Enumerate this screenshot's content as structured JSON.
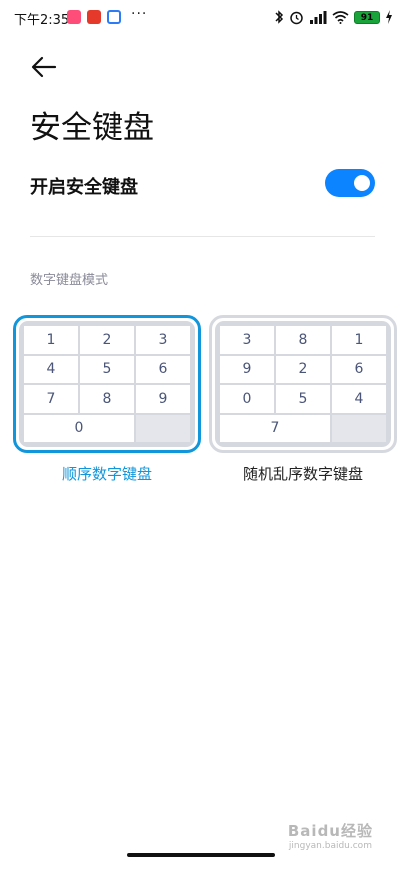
{
  "status_bar": {
    "time": "下午2:35",
    "dots": "···",
    "battery": "91",
    "app_icon_colors": [
      "#ff4d7a",
      "#e5392b",
      "#2d7cf6"
    ]
  },
  "header": {
    "back_icon": "arrow-left-icon",
    "title": "安全键盘"
  },
  "settings": {
    "toggle_label": "开启安全键盘",
    "toggle_on": true,
    "accent_color": "#0d84ff"
  },
  "section_title": "数字键盘模式",
  "keyboards": {
    "sequential": {
      "caption": "顺序数字键盘",
      "selected": true,
      "keys": [
        "1",
        "2",
        "3",
        "4",
        "5",
        "6",
        "7",
        "8",
        "9",
        "0"
      ]
    },
    "random": {
      "caption": "随机乱序数字键盘",
      "selected": false,
      "keys": [
        "3",
        "8",
        "1",
        "9",
        "2",
        "6",
        "0",
        "5",
        "4",
        "7"
      ]
    }
  },
  "watermark": {
    "main": "Baidu经验",
    "sub": "jingyan.baidu.com"
  }
}
